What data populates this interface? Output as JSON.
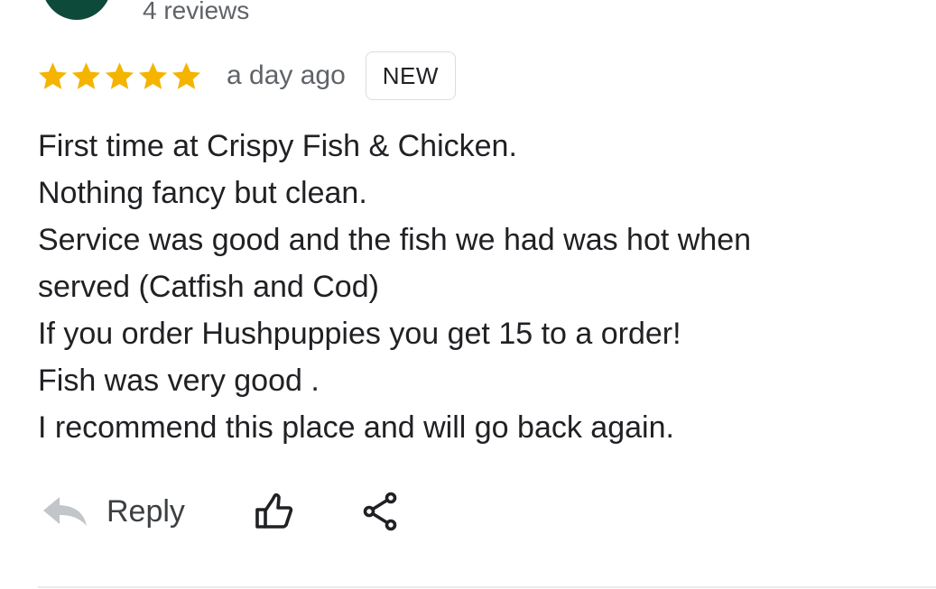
{
  "reviewer": {
    "reviews_count": "4 reviews"
  },
  "rating": {
    "stars": 5,
    "max_stars": 5,
    "star_color": "#f4b400",
    "time_ago": "a day ago",
    "badge": "NEW"
  },
  "review": {
    "lines": [
      "First time at Crispy Fish & Chicken.",
      "Nothing fancy but clean.",
      "Service was good and the fish we had was hot when",
      "served (Catfish and Cod)",
      "If you order Hushpuppies you get 15 to a order!",
      "Fish was very good .",
      "I recommend this place and will go back again."
    ]
  },
  "actions": {
    "reply_label": "Reply",
    "reply_icon": "reply-arrow-icon",
    "like_icon": "thumbs-up-icon",
    "share_icon": "share-icon"
  }
}
